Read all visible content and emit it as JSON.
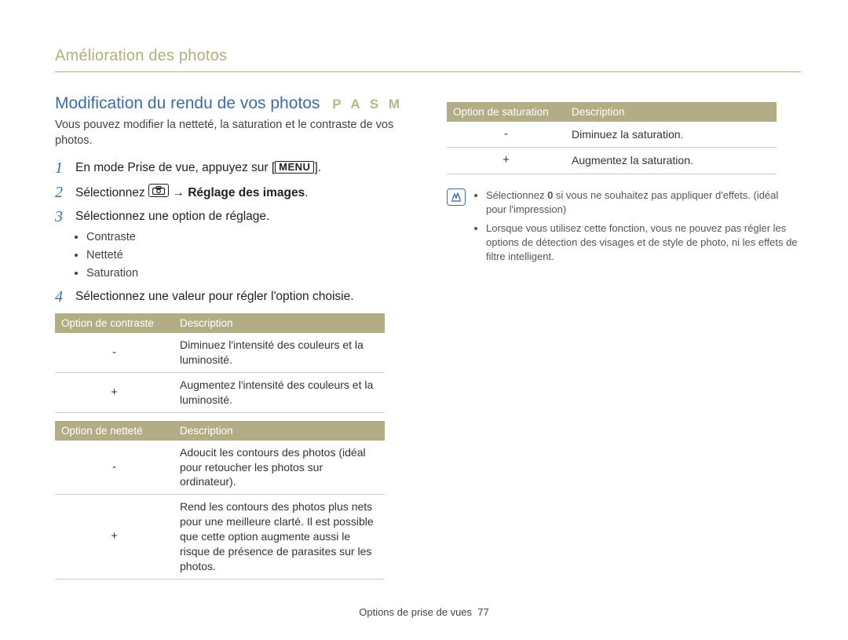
{
  "header": {
    "section_title": "Amélioration des photos"
  },
  "title": {
    "text": "Modification du rendu de vos photos",
    "mode_letters": "P A S M"
  },
  "intro": "Vous pouvez modifier la netteté, la saturation et le contraste de vos photos.",
  "steps": {
    "s1_prefix": "En mode Prise de vue, appuyez sur [",
    "s1_menu": "MENU",
    "s1_suffix": "].",
    "s2_prefix": "Sélectionnez ",
    "s2_arrow": " → ",
    "s2_bold": "Réglage des images",
    "s2_suffix": ".",
    "s3": "Sélectionnez une option de réglage.",
    "s3_bullets": [
      "Contraste",
      "Netteté",
      "Saturation"
    ],
    "s4": "Sélectionnez une valeur pour régler l'option choisie.",
    "nums": {
      "n1": "1",
      "n2": "2",
      "n3": "3",
      "n4": "4"
    }
  },
  "tables": {
    "contrast": {
      "h1": "Option de contraste",
      "h2": "Description",
      "rows": [
        {
          "sign": "-",
          "desc": "Diminuez l'intensité des couleurs et la luminosité."
        },
        {
          "sign": "+",
          "desc": "Augmentez l'intensité des couleurs et la luminosité."
        }
      ]
    },
    "sharpness": {
      "h1": "Option de netteté",
      "h2": "Description",
      "rows": [
        {
          "sign": "-",
          "desc": "Adoucit les contours des photos (idéal pour retoucher les photos sur ordinateur)."
        },
        {
          "sign": "+",
          "desc": "Rend les contours des photos plus nets pour une meilleure clarté. Il est possible que cette option augmente aussi le risque de présence de parasites sur les photos."
        }
      ]
    },
    "saturation": {
      "h1": "Option de saturation",
      "h2": "Description",
      "rows": [
        {
          "sign": "-",
          "desc": "Diminuez la saturation."
        },
        {
          "sign": "+",
          "desc": "Augmentez la saturation."
        }
      ]
    }
  },
  "notes": {
    "item1_prefix": "Sélectionnez ",
    "item1_bold": "0",
    "item1_suffix": " si vous ne souhaitez pas appliquer d'effets. (idéal pour l'impression)",
    "item2": "Lorsque vous utilisez cette fonction, vous ne pouvez pas régler les options de détection des visages et de style de photo, ni les effets de filtre intelligent."
  },
  "footer": {
    "label": "Options de prise de vues",
    "page": "77"
  }
}
